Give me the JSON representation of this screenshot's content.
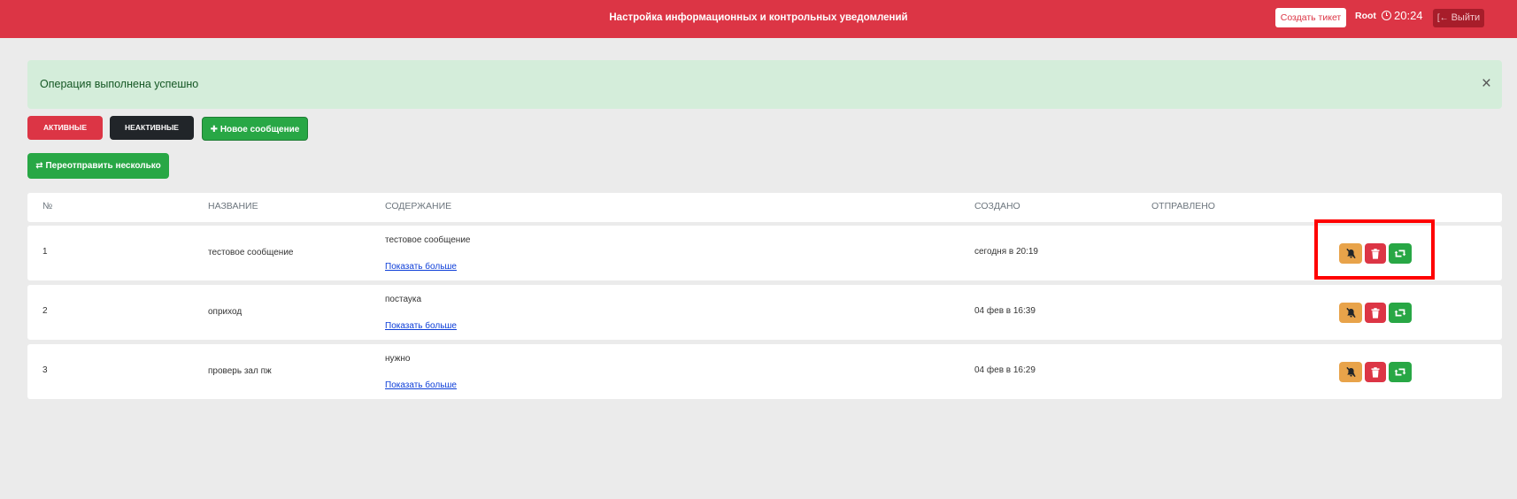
{
  "header": {
    "title": "Настройка информационных и контрольных уведомлений",
    "create_ticket": "Создать тикет",
    "user": "Root",
    "time": "20:24",
    "logout": "Выйти"
  },
  "alert": {
    "message": "Операция выполнена успешно",
    "close": "×"
  },
  "filters": {
    "active": "АКТИВНЫЕ",
    "inactive": "НЕАКТИВНЫЕ",
    "new_message": "Новое сообщение",
    "resend_several": "Переотправить несколько"
  },
  "table": {
    "columns": [
      "№",
      "НАЗВАНИЕ",
      "СОДЕРЖАНИЕ",
      "СОЗДАНО",
      "ОТПРАВЛЕНО"
    ],
    "rows": [
      {
        "num": "1",
        "name": "тестовое сообщение",
        "content": "тестовое сообщение",
        "more": "Показать больше",
        "created": "сегодня в 20:19",
        "sent": ""
      },
      {
        "num": "2",
        "name": "оприход",
        "content": "постаука",
        "more": "Показать больше",
        "created": "04 фев в 16:39",
        "sent": ""
      },
      {
        "num": "3",
        "name": "проверь зал пж",
        "content": "нужно",
        "more": "Показать больше",
        "created": "04 фев в 16:29",
        "sent": ""
      }
    ]
  },
  "colors": {
    "primary_red": "#dc3545",
    "success_green": "#28a745",
    "warning_orange": "#e8a34a",
    "dark": "#212529",
    "alert_bg": "#d4edda",
    "highlight": "#ff0000"
  }
}
